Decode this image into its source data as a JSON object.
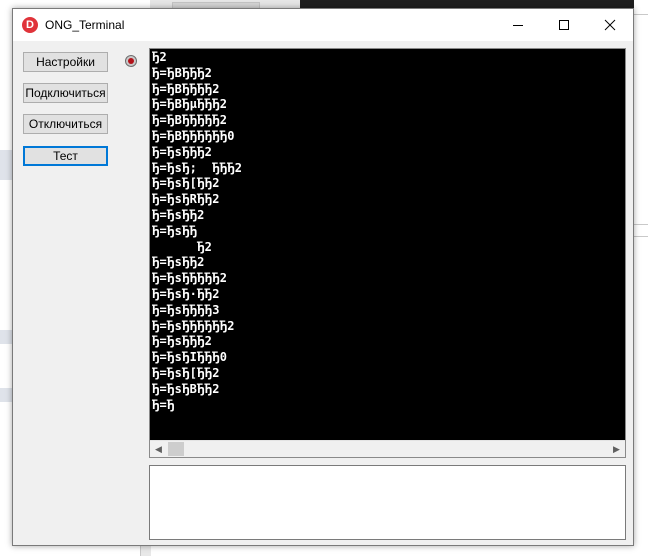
{
  "window": {
    "title": "ONG_Terminal",
    "app_icon_letter": "D"
  },
  "controls": {
    "settings_label": "Настройки",
    "connect_label": "Подключиться",
    "disconnect_label": "Отключиться",
    "test_label": "Тест"
  },
  "indicator": {
    "name": "connection-status",
    "color": "#b3121a"
  },
  "terminal": {
    "lines": [
      "Ђ2",
      "Ђ=ЂВЂЂЂ2",
      "Ђ=ЂВЂЂЂЂ2",
      "Ђ=ЂВЂµЂЂЂ2",
      "Ђ=ЂВЂЂЂЂЂ2",
      "Ђ=ЂВЂЂЂЂЂЂ0",
      "Ђ=ЂsЂЂЂ2",
      "Ђ=ЂsЂ;  ЂЂЂ2",
      "Ђ=ЂsЂ[ЂЂ2",
      "Ђ=ЂsЂRЂЂ2",
      "Ђ=ЂsЂЂ2",
      "Ђ=ЂsЂЂ",
      "      Ђ2",
      "Ђ=ЂsЂЂ2",
      "Ђ=ЂsЂЂЂЂЂ2",
      "Ђ=ЂsЂ·ЂЂ2",
      "Ђ=ЂsЂЂЂЂ3",
      "Ђ=ЂsЂЂЂЂЂЂ2",
      "Ђ=ЂsЂЂЂ2",
      "Ђ=ЂsЂIЂЂЂ0",
      "Ђ=ЂsЂ[ЂЂ2",
      "Ђ=ЂsЂВЂЂ2",
      "Ђ=Ђ"
    ],
    "text_color": "#ffffff",
    "background_color": "#000000"
  },
  "input": {
    "value": ""
  },
  "icons": {
    "minimize": "minimize-icon",
    "maximize": "maximize-icon",
    "close": "close-icon",
    "scroll_left": "chevron-left-icon",
    "scroll_right": "chevron-right-icon"
  }
}
